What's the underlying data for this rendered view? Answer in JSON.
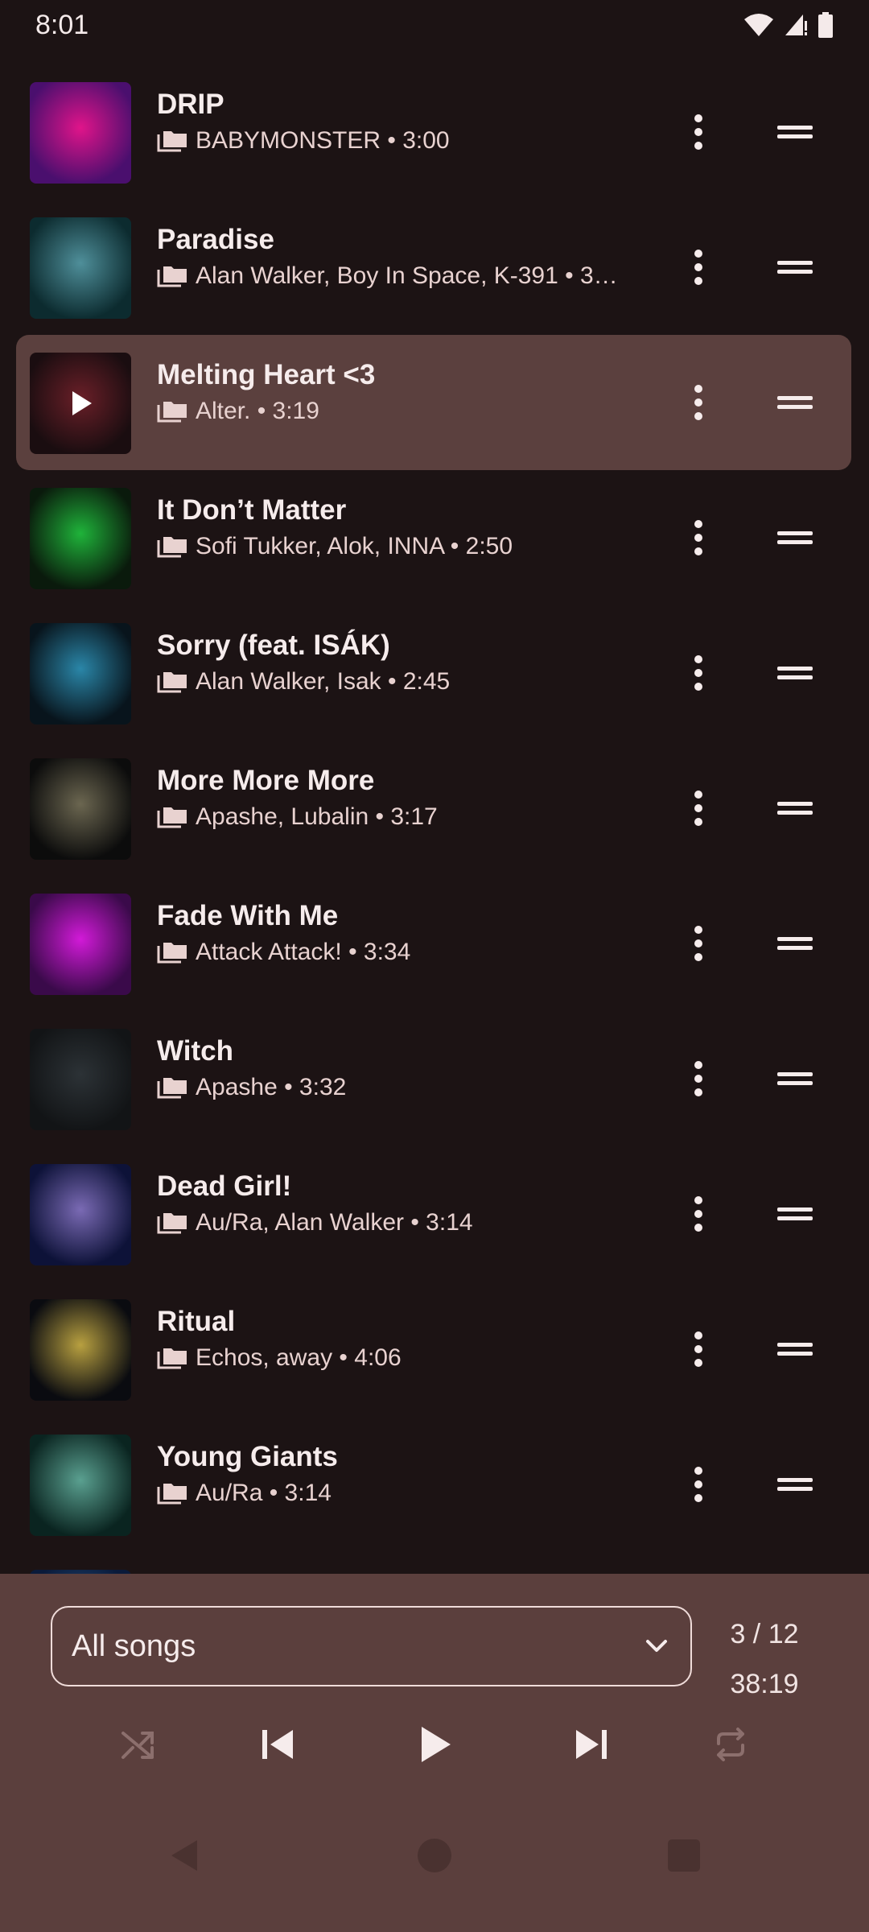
{
  "status": {
    "time": "8:01"
  },
  "songs": [
    {
      "title": "DRIP",
      "subtitle": "BABYMONSTER • 3:00",
      "art": [
        "#4a0f6e",
        "#e0148a"
      ]
    },
    {
      "title": "Paradise",
      "subtitle": "Alan Walker, Boy In Space, K-391 • 3…",
      "art": [
        "#0c2b2f",
        "#4f8f9a"
      ]
    },
    {
      "title": "Melting Heart <3",
      "subtitle": "Alter. • 3:19",
      "art": [
        "#1a0d10",
        "#6a1f28"
      ],
      "current": true
    },
    {
      "title": "It Don’t Matter",
      "subtitle": "Sofi Tukker, Alok, INNA • 2:50",
      "art": [
        "#0a1a0c",
        "#1fb33a"
      ]
    },
    {
      "title": "Sorry (feat. ISÁK)",
      "subtitle": "Alan Walker, Isak • 2:45",
      "art": [
        "#08141c",
        "#2a86a8"
      ]
    },
    {
      "title": "More More More",
      "subtitle": "Apashe, Lubalin • 3:17",
      "art": [
        "#0c0c0c",
        "#6b6650"
      ]
    },
    {
      "title": "Fade With Me",
      "subtitle": "Attack Attack! • 3:34",
      "art": [
        "#3a0a4a",
        "#d21ad8"
      ]
    },
    {
      "title": "Witch",
      "subtitle": "Apashe • 3:32",
      "art": [
        "#121416",
        "#2c3236"
      ]
    },
    {
      "title": "Dead Girl!",
      "subtitle": "Au/Ra, Alan Walker • 3:14",
      "art": [
        "#0d1238",
        "#7a6ab4"
      ]
    },
    {
      "title": "Ritual",
      "subtitle": "Echos, away • 4:06",
      "art": [
        "#0a0b10",
        "#b8a040"
      ]
    },
    {
      "title": "Young Giants",
      "subtitle": "Au/Ra • 3:14",
      "art": [
        "#0a2420",
        "#5aa090"
      ]
    },
    {
      "title": "",
      "subtitle": "",
      "art": [
        "#0a1a3a",
        "#2a5a8a"
      ]
    }
  ],
  "panel": {
    "playlist_label": "All songs",
    "position": "3 / 12",
    "total_duration": "38:19"
  },
  "colors": {
    "background": "#1c1314",
    "current_row": "#5b403e",
    "panel": "#5b3f3d",
    "disabled_icon": "#8c6f6d"
  }
}
